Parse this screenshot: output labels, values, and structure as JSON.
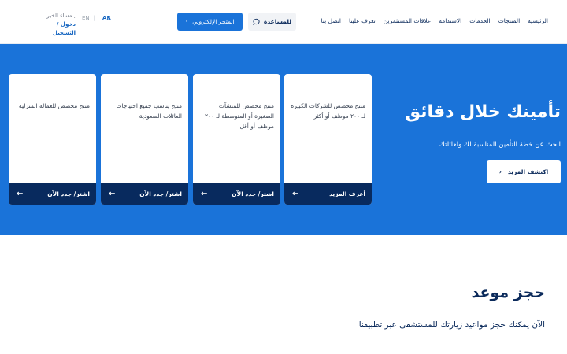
{
  "header": {
    "user": {
      "greeting": "مساء الخير ,",
      "login": "دخول / التسجيل"
    },
    "lang": {
      "en": "EN",
      "ar": "AR"
    },
    "store_label": "المتجر الإلكتروني",
    "help_label": "للمساعدة",
    "nav": [
      "الرئيسية",
      "المنتجات",
      "الخدمات",
      "الاستدامة",
      "علاقات المستثمرين",
      "تعرف علينا",
      "اتصل بنا"
    ]
  },
  "hero": {
    "title": "تأمينك خلال دقائق",
    "subtitle": "ابحث عن خطة التأمين المناسبة لك ولعائلتك",
    "explore_label": "اكتشف المزيد",
    "cards": [
      {
        "desc": "منتج مخصص للشركات الكبيرة لـ ٢٠٠ موظف أو أكثر",
        "cta": "أعرف المزيد"
      },
      {
        "desc": "منتج مخصص للمنشآت الصغيرة أو المتوسطة لـ ٢٠٠ موظف أو أقل",
        "cta": "اشتر/ جدد الآن"
      },
      {
        "desc": "منتج يناسب جميع احتياجات العائلات السعودية",
        "cta": "اشتر/ جدد الآن"
      },
      {
        "desc": "منتج مخصص للعمالة المنزلية",
        "cta": "اشتر/ جدد الآن"
      }
    ]
  },
  "booking": {
    "title": "حجز موعد",
    "text": "الآن يمكنك حجز مواعيد زيارتك للمستشفى عبر تطبيقنا"
  },
  "colors": {
    "primary": "#1a73d9",
    "navy": "#082a5e",
    "text": "#0b2a5b"
  }
}
